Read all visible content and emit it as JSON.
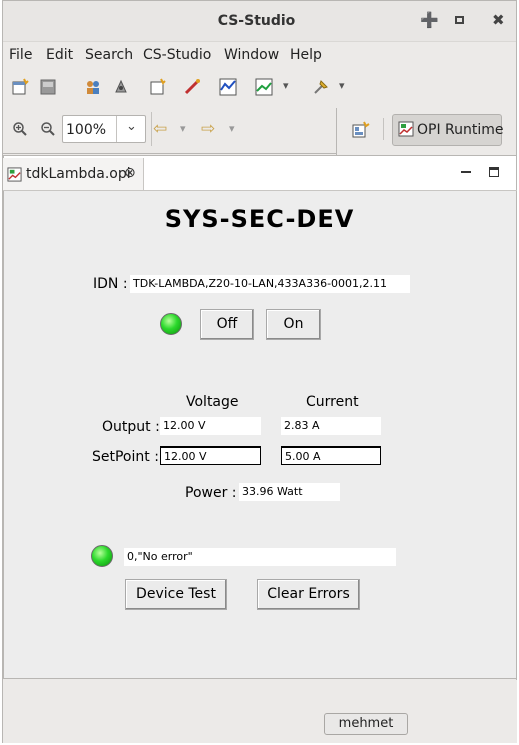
{
  "window": {
    "title": "CS-Studio"
  },
  "menu": [
    "File",
    "Edit",
    "Search",
    "CS-Studio",
    "Window",
    "Help"
  ],
  "zoom": {
    "value": "100%"
  },
  "perspective": {
    "label": "OPI Runtime"
  },
  "tab": {
    "label": "tdkLambda.opi"
  },
  "opi": {
    "heading": "SYS-SEC-DEV",
    "idn_label": "IDN :",
    "idn_value": "TDK-LAMBDA,Z20-10-LAN,433A336-0001,2.11",
    "off_label": "Off",
    "on_label": "On",
    "voltage_header": "Voltage",
    "current_header": "Current",
    "output_label": "Output :",
    "output_voltage": "12.00 V",
    "output_current": "2.83 A",
    "setpoint_label": "SetPoint :",
    "setpoint_voltage": "12.00 V",
    "setpoint_current": "5.00 A",
    "power_label": "Power :",
    "power_value": "33.96 Watt",
    "error_value": "0,\"No error\"",
    "device_test_label": "Device Test",
    "clear_errors_label": "Clear Errors"
  },
  "status": {
    "user": "mehmet"
  },
  "colors": {
    "led_on": "#2cd92c",
    "opi_background": "#ededed"
  }
}
